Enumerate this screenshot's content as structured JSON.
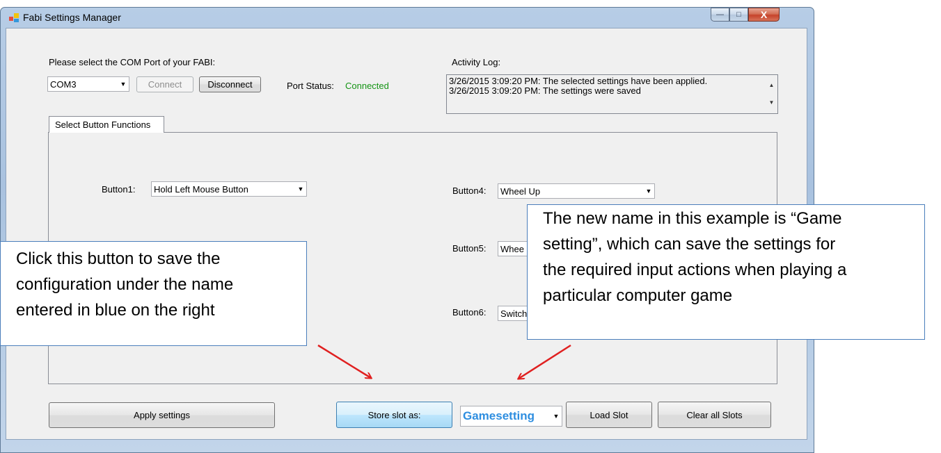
{
  "window": {
    "title": "Fabi Settings Manager",
    "minimize_glyph": "—",
    "maximize_glyph": "□",
    "close_glyph": "X"
  },
  "com_port": {
    "prompt": "Please select the COM Port of your FABI:",
    "selected": "COM3",
    "connect_label": "Connect",
    "disconnect_label": "Disconnect",
    "status_label": "Port Status:",
    "status_value": "Connected",
    "status_color": "#159415"
  },
  "activity_log": {
    "label": "Activity Log:",
    "entries": [
      "3/26/2015 3:09:20 PM: The selected settings have been applied.",
      "3/26/2015 3:09:20 PM: The settings were saved"
    ]
  },
  "tabs": [
    {
      "label": "Select Button Functions"
    }
  ],
  "buttons": {
    "b1": {
      "label": "Button1:",
      "value": "Hold Left Mouse Button"
    },
    "b4": {
      "label": "Button4:",
      "value": "Wheel Up"
    },
    "b5": {
      "label": "Button5:",
      "value": "Whee"
    },
    "b6": {
      "label": "Button6:",
      "value": "Switch"
    }
  },
  "footer": {
    "apply_label": "Apply settings",
    "store_label": "Store slot as:",
    "slot_name": "Gamesetting",
    "slot_color": "#2e8ee0",
    "load_label": "Load Slot",
    "clear_label": "Clear all Slots"
  },
  "annotations": {
    "left": [
      "Click this button to save the",
      "configuration under the name",
      "entered in blue on the right"
    ],
    "right": [
      "The new name in this example is “Game",
      "setting”, which can save the settings for",
      "the required input actions when playing a",
      "particular computer game"
    ],
    "arrow_color": "#e02020"
  }
}
